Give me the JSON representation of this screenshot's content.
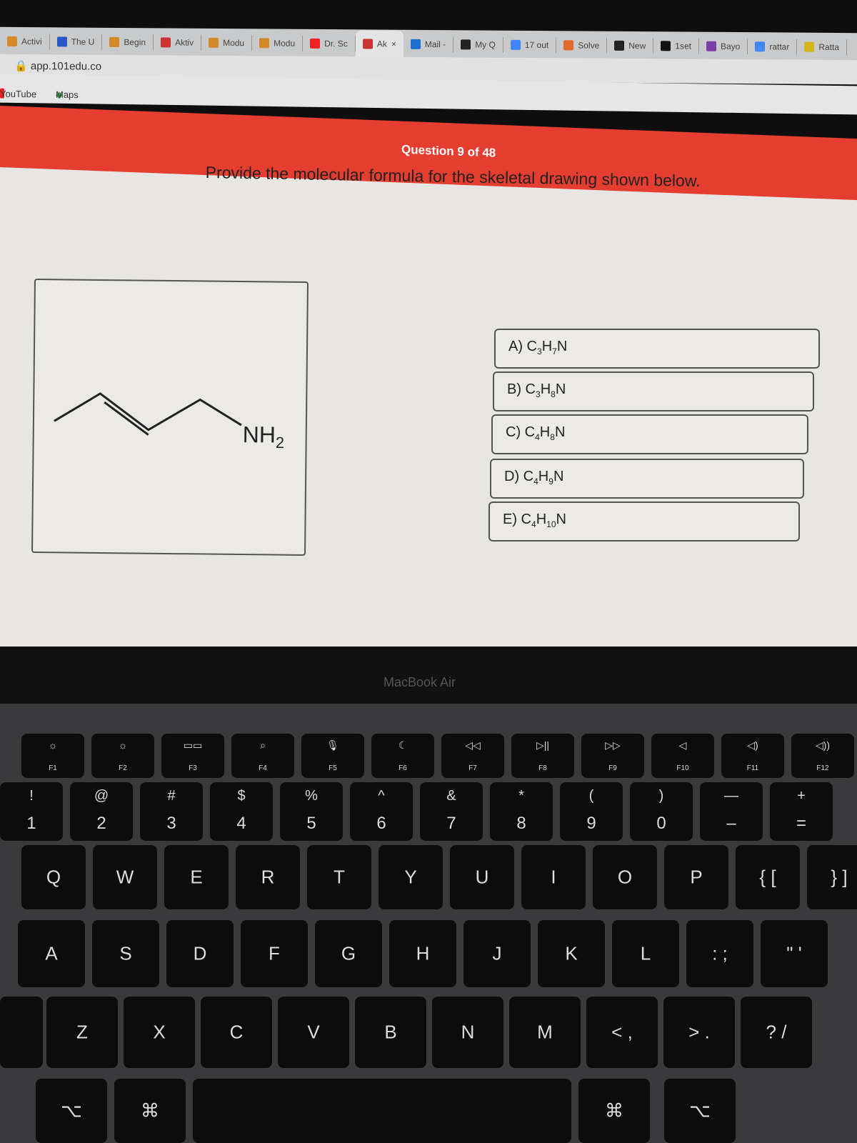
{
  "browser": {
    "tabs": [
      {
        "label": "Activi",
        "color": "#d48a2b"
      },
      {
        "label": "The U",
        "color": "#2b56c8"
      },
      {
        "label": "Begin",
        "color": "#d48a2b"
      },
      {
        "label": "Aktiv",
        "color": "#c33"
      },
      {
        "label": "Modu",
        "color": "#d48a2b"
      },
      {
        "label": "Modu",
        "color": "#d48a2b"
      },
      {
        "label": "Dr. Sc",
        "color": "#e22"
      },
      {
        "label": "Ak",
        "color": "#c33",
        "active": true
      },
      {
        "label": "Mail -",
        "color": "#1f6fd1"
      },
      {
        "label": "My Q",
        "color": "#222"
      },
      {
        "label": "17 out",
        "color": "#4285f4"
      },
      {
        "label": "Solve",
        "color": "#e0692b"
      },
      {
        "label": "New",
        "color": "#222"
      },
      {
        "label": "1set",
        "color": "#111"
      },
      {
        "label": "Bayo",
        "color": "#7b3fa8"
      },
      {
        "label": "rattar",
        "color": "#4285f4"
      },
      {
        "label": "Ratta",
        "color": "#d4b51a"
      }
    ],
    "tab_close": "×",
    "url": "app.101edu.co",
    "bookmarks": [
      "YouTube",
      "Maps"
    ]
  },
  "quiz": {
    "progress": "Question 9 of 48",
    "prompt": "Provide the molecular formula for the skeletal drawing shown below.",
    "substituent": "NH",
    "substituent_sub": "2",
    "options": [
      {
        "letter": "A)",
        "c": "3",
        "h": "7"
      },
      {
        "letter": "B)",
        "c": "3",
        "h": "8"
      },
      {
        "letter": "C)",
        "c": "4",
        "h": "8"
      },
      {
        "letter": "D)",
        "c": "4",
        "h": "9"
      },
      {
        "letter": "E)",
        "c": "4",
        "h": "10"
      }
    ],
    "accent": "#e53d2f"
  },
  "laptop": {
    "model": "MacBook Air"
  },
  "keyboard": {
    "fn": [
      [
        "☼",
        "F1"
      ],
      [
        "☼",
        "F2"
      ],
      [
        "▭▭",
        "F3"
      ],
      [
        "⌕",
        "F4"
      ],
      [
        "🎙",
        "F5"
      ],
      [
        "☾",
        "F6"
      ],
      [
        "◁◁",
        "F7"
      ],
      [
        "▷||",
        "F8"
      ],
      [
        "▷▷",
        "F9"
      ],
      [
        "◁",
        "F10"
      ],
      [
        "◁)",
        "F11"
      ],
      [
        "◁))",
        "F12"
      ]
    ],
    "num": [
      [
        "!",
        "1"
      ],
      [
        "@",
        "2"
      ],
      [
        "#",
        "3"
      ],
      [
        "$",
        "4"
      ],
      [
        "%",
        "5"
      ],
      [
        "^",
        "6"
      ],
      [
        "&",
        "7"
      ],
      [
        "*",
        "8"
      ],
      [
        "(",
        "9"
      ],
      [
        ")",
        "0"
      ],
      [
        "—",
        "–"
      ],
      [
        "+",
        "="
      ]
    ],
    "q": [
      "Q",
      "W",
      "E",
      "R",
      "T",
      "Y",
      "U",
      "I",
      "O",
      "P",
      "{ [",
      "} ]"
    ],
    "a": [
      "A",
      "S",
      "D",
      "F",
      "G",
      "H",
      "J",
      "K",
      "L",
      ": ;",
      "\" '"
    ],
    "z": [
      "Z",
      "X",
      "C",
      "V",
      "B",
      "N",
      "M",
      "< ,",
      "> .",
      "? /"
    ],
    "bottom": [
      "⌥",
      "⌘",
      "⌘",
      "⌥"
    ]
  }
}
